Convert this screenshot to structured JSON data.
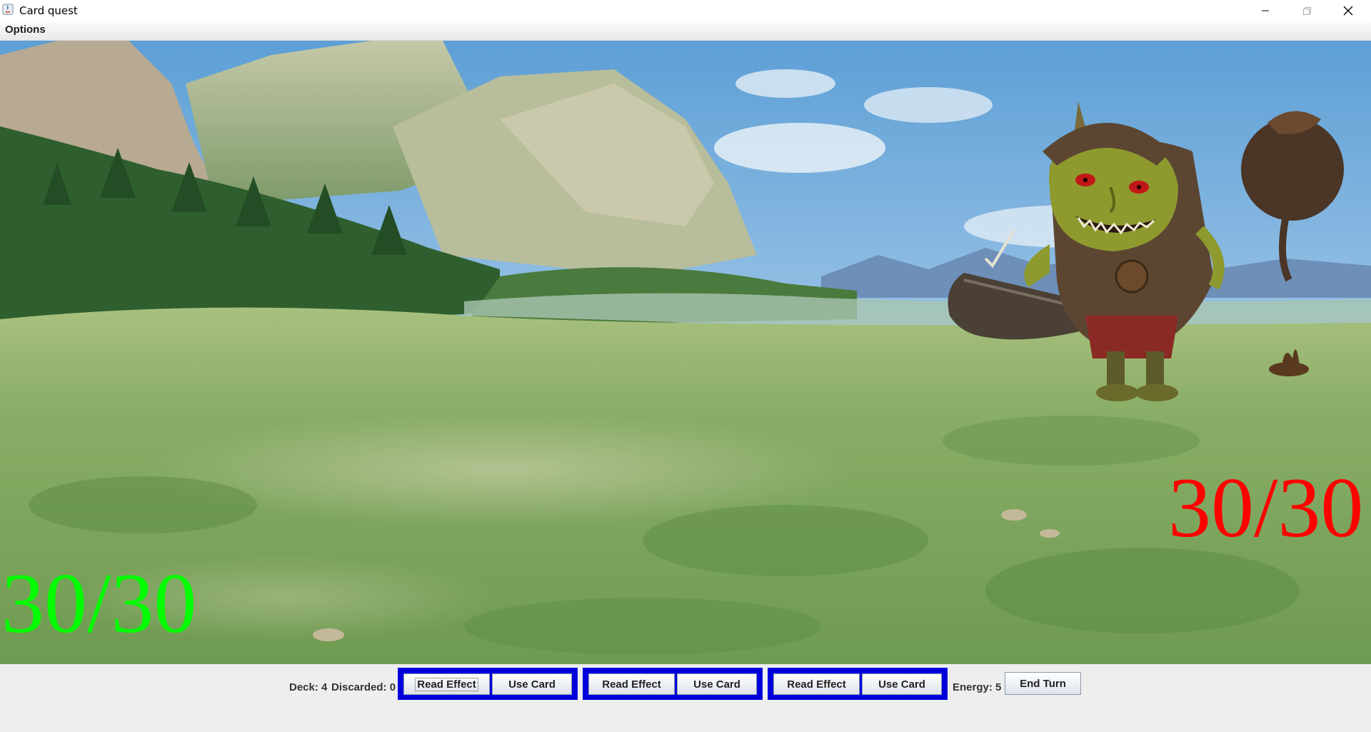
{
  "window": {
    "title": "Card quest"
  },
  "menu": {
    "options_label": "Options"
  },
  "battle": {
    "player_hp": "30/30",
    "player_hp_color": "#00ff00",
    "enemy_hp": "30/30",
    "enemy_hp_color": "#ff0000",
    "enemy_icon": "goblin-enemy-icon",
    "background_icon": "meadow-landscape"
  },
  "status": {
    "deck_label": "Deck: 4",
    "discarded_label": "Discarded: 0",
    "energy_label": "Energy: 5"
  },
  "hand": [
    {
      "read_label": "Read Effect",
      "use_label": "Use Card"
    },
    {
      "read_label": "Read Effect",
      "use_label": "Use Card"
    },
    {
      "read_label": "Read Effect",
      "use_label": "Use Card"
    }
  ],
  "controls": {
    "end_turn_label": "End Turn"
  },
  "colors": {
    "card_border": "#0000dd"
  }
}
